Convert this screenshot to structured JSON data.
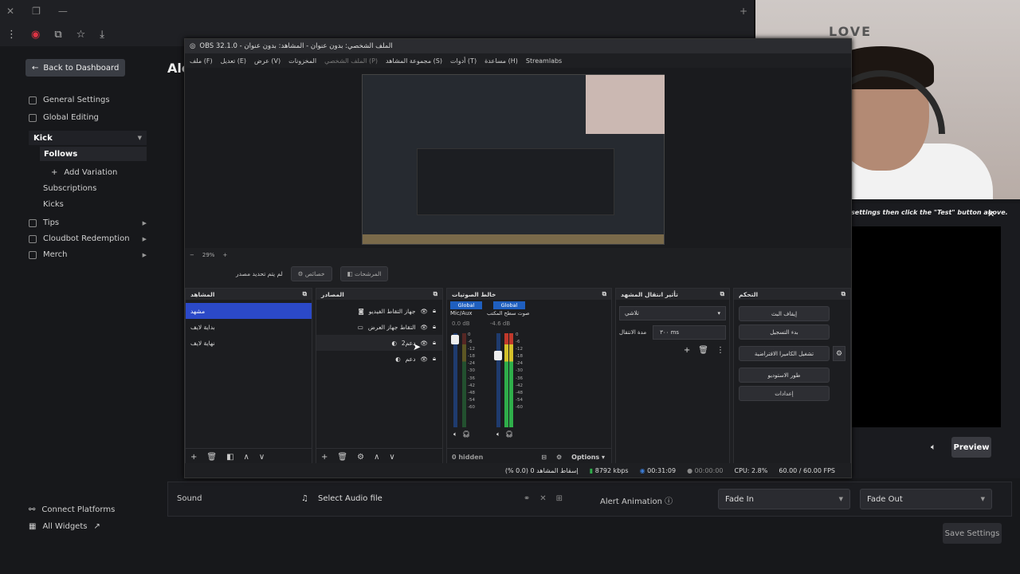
{
  "browser": {
    "tab_new": "+"
  },
  "dashboard": {
    "back_label": "Back to Dashboard",
    "page_title": "Ale",
    "sidebar": [
      {
        "label": "General Settings"
      },
      {
        "label": "Global Editing"
      },
      {
        "label": "Kick"
      },
      {
        "label": "Follows"
      },
      {
        "label": "Add Variation"
      },
      {
        "label": "Subscriptions"
      },
      {
        "label": "Kicks"
      },
      {
        "label": "Tips"
      },
      {
        "label": "Cloudbot Redemption"
      },
      {
        "label": "Merch"
      }
    ],
    "footer": {
      "connect": "Connect Platforms",
      "widgets": "All Widgets"
    },
    "bottom": {
      "sound_label": "Sound",
      "select_audio": "Select Audio file",
      "alert_animation": "Alert Animation",
      "fade_in": "Fade In",
      "fade_out": "Fade Out",
      "save": "Save Settings"
    },
    "right_panel": {
      "hint": "settings then click the \"Test\" button above.",
      "preview": "Preview"
    }
  },
  "webcam": {
    "sign": "LOVE"
  },
  "obs": {
    "title": "OBS 32.1.0 - الملف الشخصي: بدون عنوان - المشاهد: بدون عنوان",
    "menu": [
      "ملف (F)",
      "تعديل (E)",
      "عرض (V)",
      "المخزونات",
      "الملف الشخصي (P)",
      "مجموعة المشاهد (S)",
      "أدوات (T)",
      "مساعدة (H)",
      "Streamlabs"
    ],
    "zoom": "29%",
    "src_bar": {
      "no_source": "لم يتم تحديد مصدر",
      "props": "خصائص",
      "filters": "المرشحات"
    },
    "docks": {
      "scenes": {
        "title": "المشاهد",
        "items": [
          "مشهد",
          "بداية لايف",
          "نهاية لايف"
        ]
      },
      "sources": {
        "title": "المصادر",
        "items": [
          "جهاز التقاط الفيديو",
          "التقاط جهاز العرض",
          "دعم2",
          "دعم"
        ]
      },
      "mixer": {
        "title": "خالط الصوتيات",
        "ch1_badge": "Global",
        "ch1_name": "Mic/Aux",
        "ch1_db": "0.0 dB",
        "ch2_badge": "Global",
        "ch2_name": "صوت سطح المكتب",
        "ch2_db": "-4.6 dB",
        "scale": [
          "0",
          "-6",
          "-12",
          "-18",
          "-24",
          "-30",
          "-36",
          "-42",
          "-48",
          "-54",
          "-60"
        ],
        "hidden": "0 hidden",
        "options": "Options"
      },
      "transitions": {
        "title": "تأثير انتقال المشهد",
        "type": "تلاشي",
        "duration_label": "مدة الانتقال",
        "duration": "٣٠٠ ms"
      },
      "controls": {
        "title": "التحكم",
        "buttons": [
          "إيقاف البث",
          "بدء التسجيل",
          "تشغيل الكاميرا الافتراضية",
          "طور الاستوديو",
          "إعدادات"
        ]
      }
    },
    "status": {
      "dropped": "إسقاط المشاهد 0 (0.0 %)",
      "kbps": "8792 kbps",
      "live": "00:31:09",
      "rec": "00:00:00",
      "cpu": "CPU: 2.8%",
      "fps": "60.00 / 60.00 FPS"
    }
  }
}
